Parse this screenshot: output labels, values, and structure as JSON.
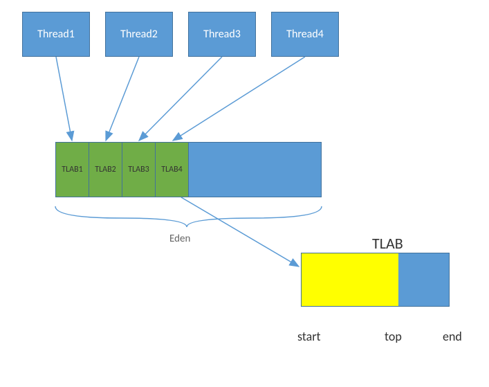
{
  "threads": [
    {
      "label": "Thread1"
    },
    {
      "label": "Thread2"
    },
    {
      "label": "Thread3"
    },
    {
      "label": "Thread4"
    }
  ],
  "tlabs": [
    {
      "label": "TLAB1"
    },
    {
      "label": "TLAB2"
    },
    {
      "label": "TLAB3"
    },
    {
      "label": "TLAB4"
    }
  ],
  "eden_label": "Eden",
  "tlab_detail": {
    "title": "TLAB",
    "markers": {
      "start": "start",
      "top": "top",
      "end": "end"
    }
  },
  "colors": {
    "thread_bg": "#5b9bd5",
    "tlab_bg": "#70ad47",
    "used_bg": "#ffff00",
    "border": "#41719c"
  }
}
